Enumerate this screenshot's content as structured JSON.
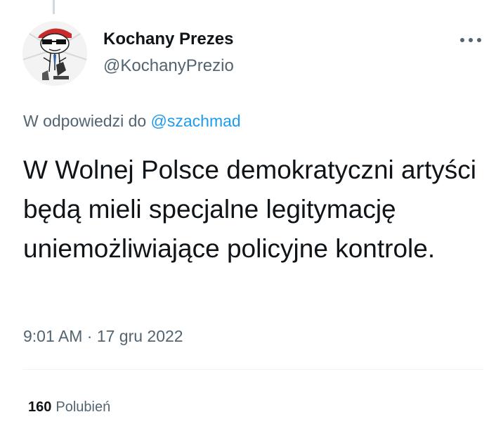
{
  "tweet": {
    "author": {
      "display_name": "Kochany Prezes",
      "handle": "@KochanyPrezio",
      "avatar_icon": "meme-character-with-sunglasses-avatar"
    },
    "more_icon": "ellipsis-icon",
    "reply_context": {
      "prefix": "W odpowiedzi do",
      "mention": "@szachmad"
    },
    "text": "W Wolnej Polsce demokratyczni artyści będą mieli specjalne legitymację uniemożliwiające policyjne kontrole.",
    "timestamp": "9:01 AM · 17 gru 2022",
    "stats": {
      "likes_count": "160",
      "likes_label": "Polubień"
    }
  },
  "colors": {
    "text_primary": "#0f1419",
    "text_secondary": "#536471",
    "link": "#1d9bf0",
    "divider": "#eff3f4",
    "thread_line": "#cfd9de"
  }
}
